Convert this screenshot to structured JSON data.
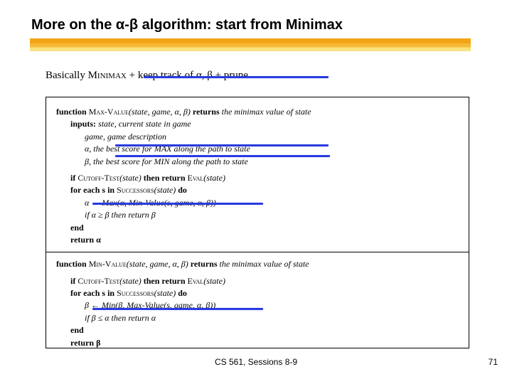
{
  "title": {
    "pre": "More on the ",
    "alpha": "α",
    "dash": "-",
    "beta": "β",
    "post": " algorithm: start from Minimax"
  },
  "basically": {
    "lead": "Basically ",
    "minimax": "Minimax",
    "tail": " + keep track of α, β + prune"
  },
  "max": {
    "sig_fn": "function ",
    "sig_name": "Max-Value",
    "sig_args": "(state, game, α, β) ",
    "sig_ret": "returns ",
    "sig_rettext": "the minimax value of state",
    "inputs_kw": "inputs: ",
    "in_state": "state, current state in game",
    "in_game": "game, game description",
    "in_alpha": "α, the best score for MAX along the path to state",
    "in_beta": "β, the best score for MIN along the path to state",
    "if_kw": "if ",
    "cutoff": "Cutoff-Test",
    "cutoff_arg": "(state) ",
    "then_ret": "then return ",
    "eval": "Eval",
    "eval_arg": "(state)",
    "foreach": "for each s in ",
    "succ": "Successors",
    "succ_arg": "(state) ",
    "do": "do",
    "update": "α ← Max(α, Min-Value(s, game, α, β))",
    "prune": "if α ≥ β then return β",
    "end": "end",
    "ret": "return α"
  },
  "min": {
    "sig_fn": "function ",
    "sig_name": "Min-Value",
    "sig_args": "(state, game, α, β) ",
    "sig_ret": "returns ",
    "sig_rettext": "the minimax value of state",
    "if_kw": "if ",
    "cutoff": "Cutoff-Test",
    "cutoff_arg": "(state) ",
    "then_ret": "then return ",
    "eval": "Eval",
    "eval_arg": "(state)",
    "foreach": "for each s in ",
    "succ": "Successors",
    "succ_arg": "(state) ",
    "do": "do",
    "update": "β ← Min(β, Max-Value(s, game, α, β))",
    "prune": "if β ≤ α then return α",
    "end": "end",
    "ret": "return β"
  },
  "footer": "CS 561,  Sessions 8-9",
  "page": "71"
}
